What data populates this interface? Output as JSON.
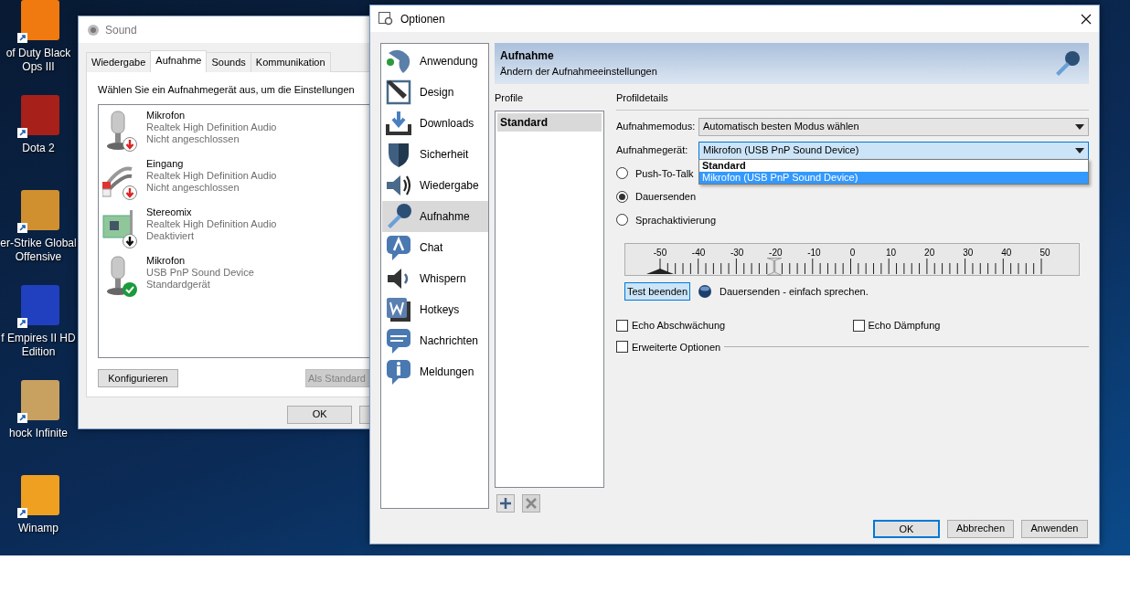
{
  "desktop_icons": [
    {
      "label": "of Duty Black Ops III",
      "color": "#f07a10"
    },
    {
      "label": "Dota 2",
      "color": "#a8201a"
    },
    {
      "label": "er-Strike Global Offensive",
      "color": "#d09030"
    },
    {
      "label": "f Empires II HD Edition",
      "color": "#2040c0"
    },
    {
      "label": "hock Infinite",
      "color": "#c8a060"
    },
    {
      "label": "Winamp",
      "color": "#f0a020"
    }
  ],
  "sound_window": {
    "title": "Sound",
    "tabs": [
      {
        "label": "Wiedergabe",
        "selected": false
      },
      {
        "label": "Aufnahme",
        "selected": true
      },
      {
        "label": "Sounds",
        "selected": false
      },
      {
        "label": "Kommunikation",
        "selected": false
      }
    ],
    "instruction": "Wählen Sie ein Aufnahmegerät aus, um die Einstellungen",
    "devices": [
      {
        "name": "Mikrofon",
        "driver": "Realtek High Definition Audio",
        "status": "Nicht angeschlossen",
        "kind": "mic",
        "connected": false
      },
      {
        "name": "Eingang",
        "driver": "Realtek High Definition Audio",
        "status": "Nicht angeschlossen",
        "kind": "cable",
        "connected": false
      },
      {
        "name": "Stereomix",
        "driver": "Realtek High Definition Audio",
        "status": "Deaktiviert",
        "kind": "card",
        "enabled": false
      },
      {
        "name": "Mikrofon",
        "driver": "USB PnP Sound Device",
        "status": "Standardgerät",
        "kind": "mic",
        "default": true
      }
    ],
    "buttons": [
      {
        "label": "Konfigurieren",
        "disabled": false
      },
      {
        "label": "Als Standard",
        "disabled": true
      }
    ],
    "dialog_buttons": [
      {
        "label": "OK"
      }
    ]
  },
  "options_window": {
    "title": "Optionen",
    "nav": [
      {
        "label": "Anwendung",
        "kind": "app",
        "selected": false
      },
      {
        "label": "Design",
        "kind": "design",
        "selected": false
      },
      {
        "label": "Downloads",
        "kind": "download",
        "selected": false
      },
      {
        "label": "Sicherheit",
        "kind": "shield",
        "selected": false
      },
      {
        "label": "Wiedergabe",
        "kind": "speaker",
        "selected": false
      },
      {
        "label": "Aufnahme",
        "kind": "mic",
        "selected": true
      },
      {
        "label": "Chat",
        "kind": "chat",
        "selected": false
      },
      {
        "label": "Whispern",
        "kind": "whisper",
        "selected": false
      },
      {
        "label": "Hotkeys",
        "kind": "hotkey",
        "selected": false
      },
      {
        "label": "Nachrichten",
        "kind": "message",
        "selected": false
      },
      {
        "label": "Meldungen",
        "kind": "info",
        "selected": false
      }
    ],
    "header": {
      "title": "Aufnahme",
      "subtitle": "Ändern der Aufnahmeeinstellungen"
    },
    "profiles": {
      "label": "Profile",
      "items": [
        {
          "label": "Standard",
          "selected": true
        }
      ]
    },
    "details": {
      "label": "Profildetails",
      "mode": {
        "label": "Aufnahmemodus:",
        "value": "Automatisch besten Modus wählen"
      },
      "device": {
        "label": "Aufnahmegerät:",
        "value": "Mikrofon (USB PnP Sound Device)",
        "expanded": true,
        "options": [
          {
            "label": "Standard",
            "selected": false
          },
          {
            "label": "Mikrofon (USB PnP Sound Device)",
            "selected": true
          }
        ]
      },
      "transmit": [
        {
          "label": "Push-To-Talk",
          "selected": false
        },
        {
          "label": "Dauersenden",
          "selected": true
        },
        {
          "label": "Sprachaktivierung",
          "selected": false
        }
      ],
      "meter": {
        "scale": [
          "-50",
          "-40",
          "-30",
          "-20",
          "-10",
          "0",
          "10",
          "20",
          "30",
          "40",
          "50"
        ],
        "level": 0.3
      },
      "test_button": "Test beenden",
      "status_text": "Dauersenden - einfach sprechen.",
      "echo": [
        {
          "label": "Echo Abschwächung",
          "checked": false
        },
        {
          "label": "Echo Dämpfung",
          "checked": false
        }
      ],
      "advanced": {
        "label": "Erweiterte Optionen",
        "checked": false
      }
    },
    "buttons": [
      {
        "label": "OK",
        "default": true
      },
      {
        "label": "Abbrechen",
        "default": false
      },
      {
        "label": "Anwenden",
        "default": false
      }
    ]
  }
}
